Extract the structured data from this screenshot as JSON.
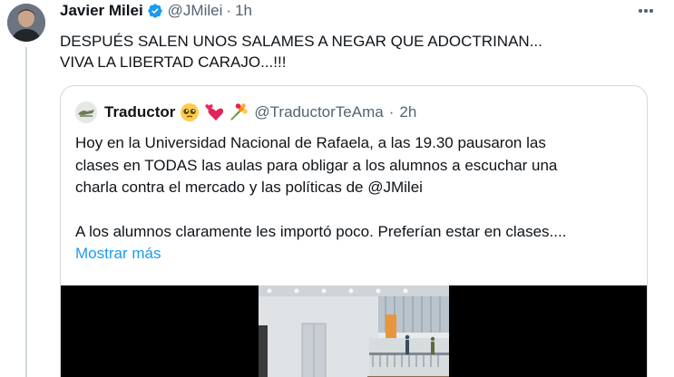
{
  "tweet": {
    "author_name": "Javier Milei",
    "handle": "@JMilei",
    "separator": "·",
    "time": "1h",
    "text_lines": [
      "DESPUÉS SALEN UNOS SALAMES A NEGAR QUE ADOCTRINAN...",
      "VIVA LA LIBERTAD CARAJO...!!!"
    ]
  },
  "quoted": {
    "author_name": "Traductor",
    "emojis": [
      "pleading-face",
      "two-hearts",
      "bouquet"
    ],
    "handle": "@TraductorTeAma",
    "separator": "·",
    "time": "2h",
    "text_lines": [
      "Hoy en la Universidad Nacional de Rafaela, a las 19.30 pausaron las",
      "clases en TODAS las aulas para obligar a los alumnos a escuchar una",
      "charla contra el mercado y las políticas de "
    ],
    "mention": "@JMilei",
    "text_line_2": "A los alumnos claramente les importó poco. Preferían estar en clases....",
    "show_more": "Mostrar más"
  },
  "colors": {
    "accent": "#1d9bf0",
    "text_primary": "#0f1419",
    "text_secondary": "#536471",
    "border": "#cfd9de"
  }
}
